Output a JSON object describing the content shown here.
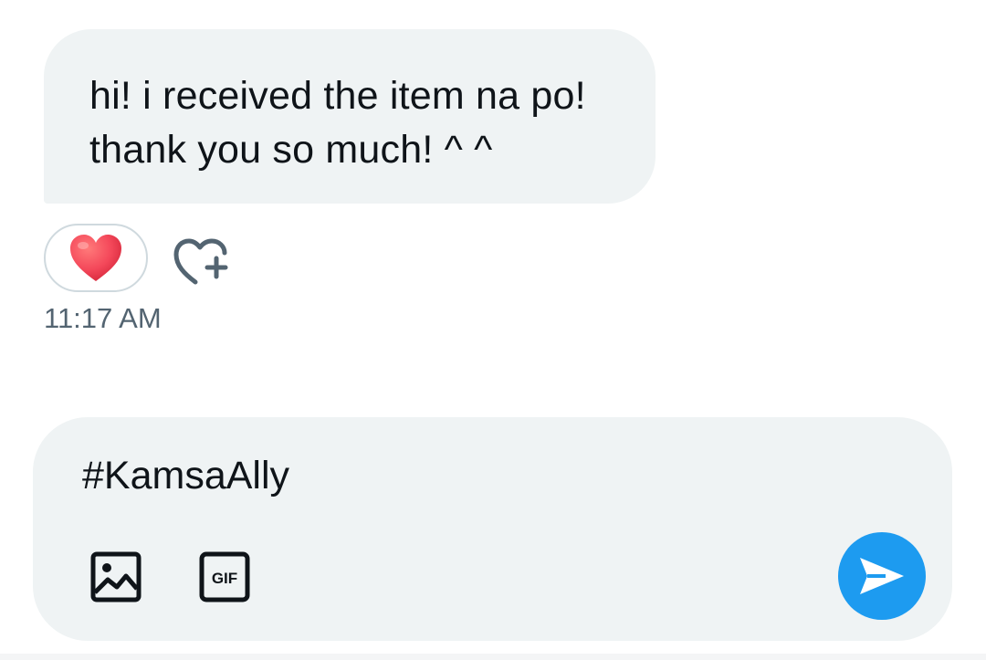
{
  "message": {
    "text": "hi! i received the item na po!\nthank you so much! ^ ^",
    "reaction": "❤️",
    "timestamp": "11:17 AM"
  },
  "composer": {
    "value": "#KamsaAlly",
    "gif_label": "GIF"
  },
  "icons": {
    "add_reaction": "heart-plus-icon",
    "image": "image-icon",
    "gif": "gif-icon",
    "send": "send-icon"
  },
  "colors": {
    "bubble_bg": "#eff3f4",
    "accent": "#1d9bf0",
    "heart": "#f4485a",
    "muted": "#536471"
  }
}
